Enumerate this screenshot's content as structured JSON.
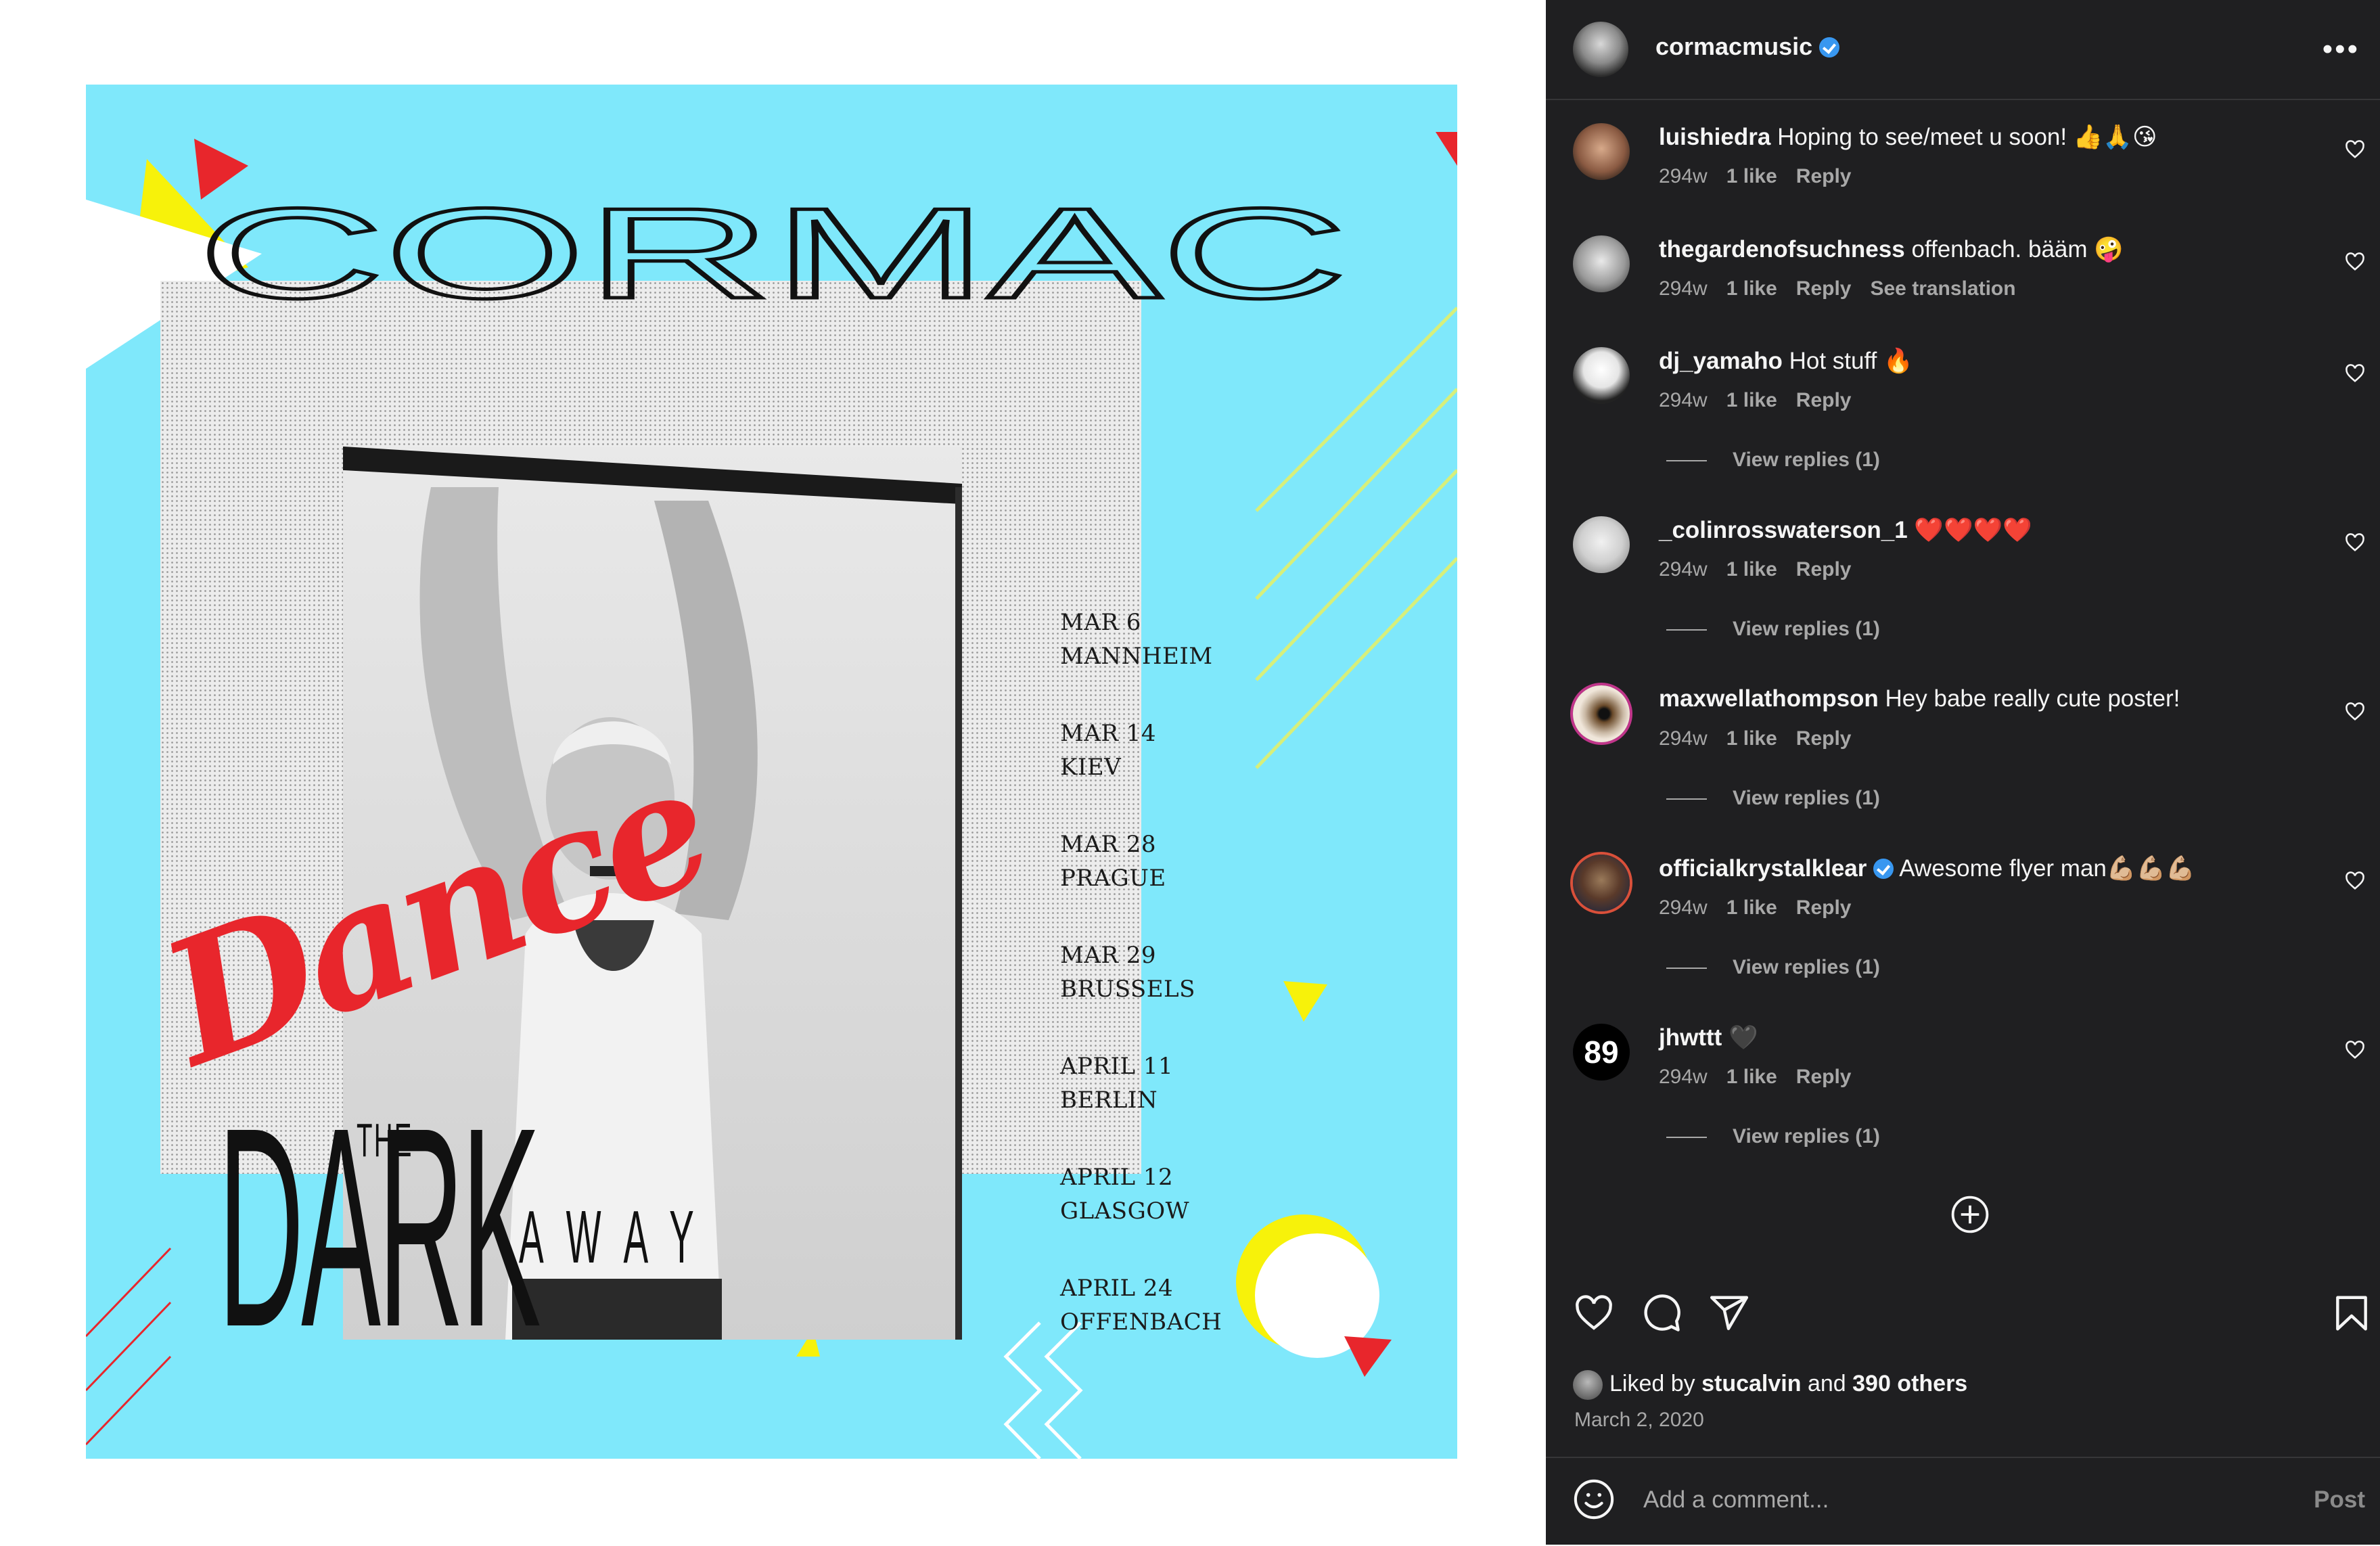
{
  "poster": {
    "title": "CORMAC",
    "script_word": "Dance",
    "tagline_the": "THE",
    "tagline_dark": "DARK",
    "tagline_away": "AWAY",
    "tour_dates": [
      {
        "day": "MAR 6",
        "city": "MANNHEIM"
      },
      {
        "day": "MAR 14",
        "city": "KIEV"
      },
      {
        "day": "MAR 28",
        "city": "PRAGUE"
      },
      {
        "day": "MAR 29",
        "city": "BRUSSELS"
      },
      {
        "day": "APRIL 11",
        "city": "BERLIN"
      },
      {
        "day": "APRIL 12",
        "city": "GLASGOW"
      },
      {
        "day": "APRIL 24",
        "city": "OFFENBACH"
      }
    ],
    "colors": {
      "background": "#7fe8fb",
      "red": "#e8262c",
      "yellow": "#f7f20a"
    }
  },
  "header": {
    "username": "cormacmusic",
    "verified": true,
    "more_icon": "more-horizontal-icon"
  },
  "comments": [
    {
      "user": "luishiedra",
      "text": "Hoping to see/meet u soon! 👍🙏😘",
      "time": "294w",
      "likes": "1 like",
      "reply": "Reply",
      "extra": "",
      "replies": ""
    },
    {
      "user": "thegardenofsuchness",
      "text": "offenbach. bääm 🤪",
      "time": "294w",
      "likes": "1 like",
      "reply": "Reply",
      "extra": "See translation",
      "replies": ""
    },
    {
      "user": "dj_yamaho",
      "text": "Hot stuff 🔥",
      "time": "294w",
      "likes": "1 like",
      "reply": "Reply",
      "extra": "",
      "replies": "View replies (1)"
    },
    {
      "user": "_colinrosswaterson_1",
      "text": "❤️❤️❤️❤️",
      "time": "294w",
      "likes": "1 like",
      "reply": "Reply",
      "extra": "",
      "replies": "View replies (1)"
    },
    {
      "user": "maxwellathompson",
      "text": "Hey babe really cute poster!",
      "time": "294w",
      "likes": "1 like",
      "reply": "Reply",
      "extra": "",
      "replies": "View replies (1)"
    },
    {
      "user": "officialkrystalklear",
      "text": "Awesome flyer man💪🏼💪🏼💪🏼",
      "time": "294w",
      "likes": "1 like",
      "reply": "Reply",
      "extra": "",
      "replies": "View replies (1)",
      "verified": true
    },
    {
      "user": "jhwttt",
      "text": "🖤",
      "time": "294w",
      "likes": "1 like",
      "reply": "Reply",
      "extra": "",
      "replies": "View replies (1)",
      "avatar_text": "89"
    }
  ],
  "footer": {
    "liked_prefix": "Liked by",
    "liked_user": "stucalvin",
    "liked_and": "and",
    "liked_others": "390 others",
    "date": "March 2, 2020",
    "comment_placeholder": "Add a comment...",
    "post_label": "Post"
  },
  "colors": {
    "panel_bg": "#1f1f21",
    "muted_text": "#a8a8a8",
    "verified_blue": "#3897f0"
  }
}
